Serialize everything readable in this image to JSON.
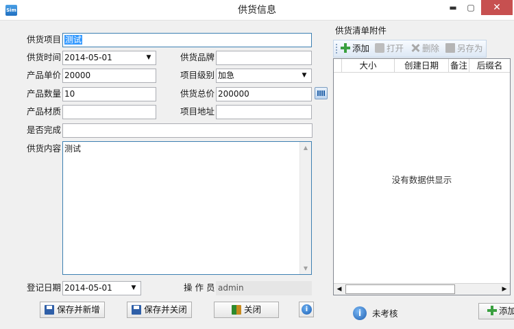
{
  "window": {
    "title": "供货信息",
    "icon_text": "Sim",
    "min_glyph": "▬",
    "max_glyph": "▢",
    "close_glyph": "✕"
  },
  "form": {
    "project_label": "供货项目",
    "project_value": "测试",
    "supply_time_label": "供货时间",
    "supply_time_value": "2014-05-01",
    "brand_label": "供货品牌",
    "brand_value": "",
    "unit_price_label": "产品单价",
    "unit_price_value": "20000",
    "level_label": "项目级别",
    "level_value": "加急",
    "quantity_label": "产品数量",
    "quantity_value": "10",
    "total_label": "供货总价",
    "total_value": "200000",
    "material_label": "产品材质",
    "material_value": "",
    "address_label": "项目地址",
    "address_value": "",
    "completed_label": "是否完成",
    "completed_value": "",
    "content_label": "供货内容",
    "content_value": "测试",
    "register_date_label": "登记日期",
    "register_date_value": "2014-05-01",
    "operator_label": "操 作 员",
    "operator_value": "admin",
    "dropdown_glyph": "▼"
  },
  "buttons": {
    "save_new": "保存并新增",
    "save_close": "保存并关闭",
    "close": "关闭",
    "info_glyph": "i"
  },
  "attachments": {
    "title": "供货清单附件",
    "toolbar": {
      "add": "添加",
      "open": "打开",
      "delete": "删除",
      "save_as": "另存为"
    },
    "columns": [
      "",
      "大小",
      "创建日期",
      "备注",
      "后缀名"
    ],
    "empty_message": "没有数据供显示",
    "scroll_left": "◀",
    "scroll_right": "▶"
  },
  "status": {
    "audit_text": "未考核",
    "icon_glyph": "i",
    "add_button_partial": "添加"
  }
}
